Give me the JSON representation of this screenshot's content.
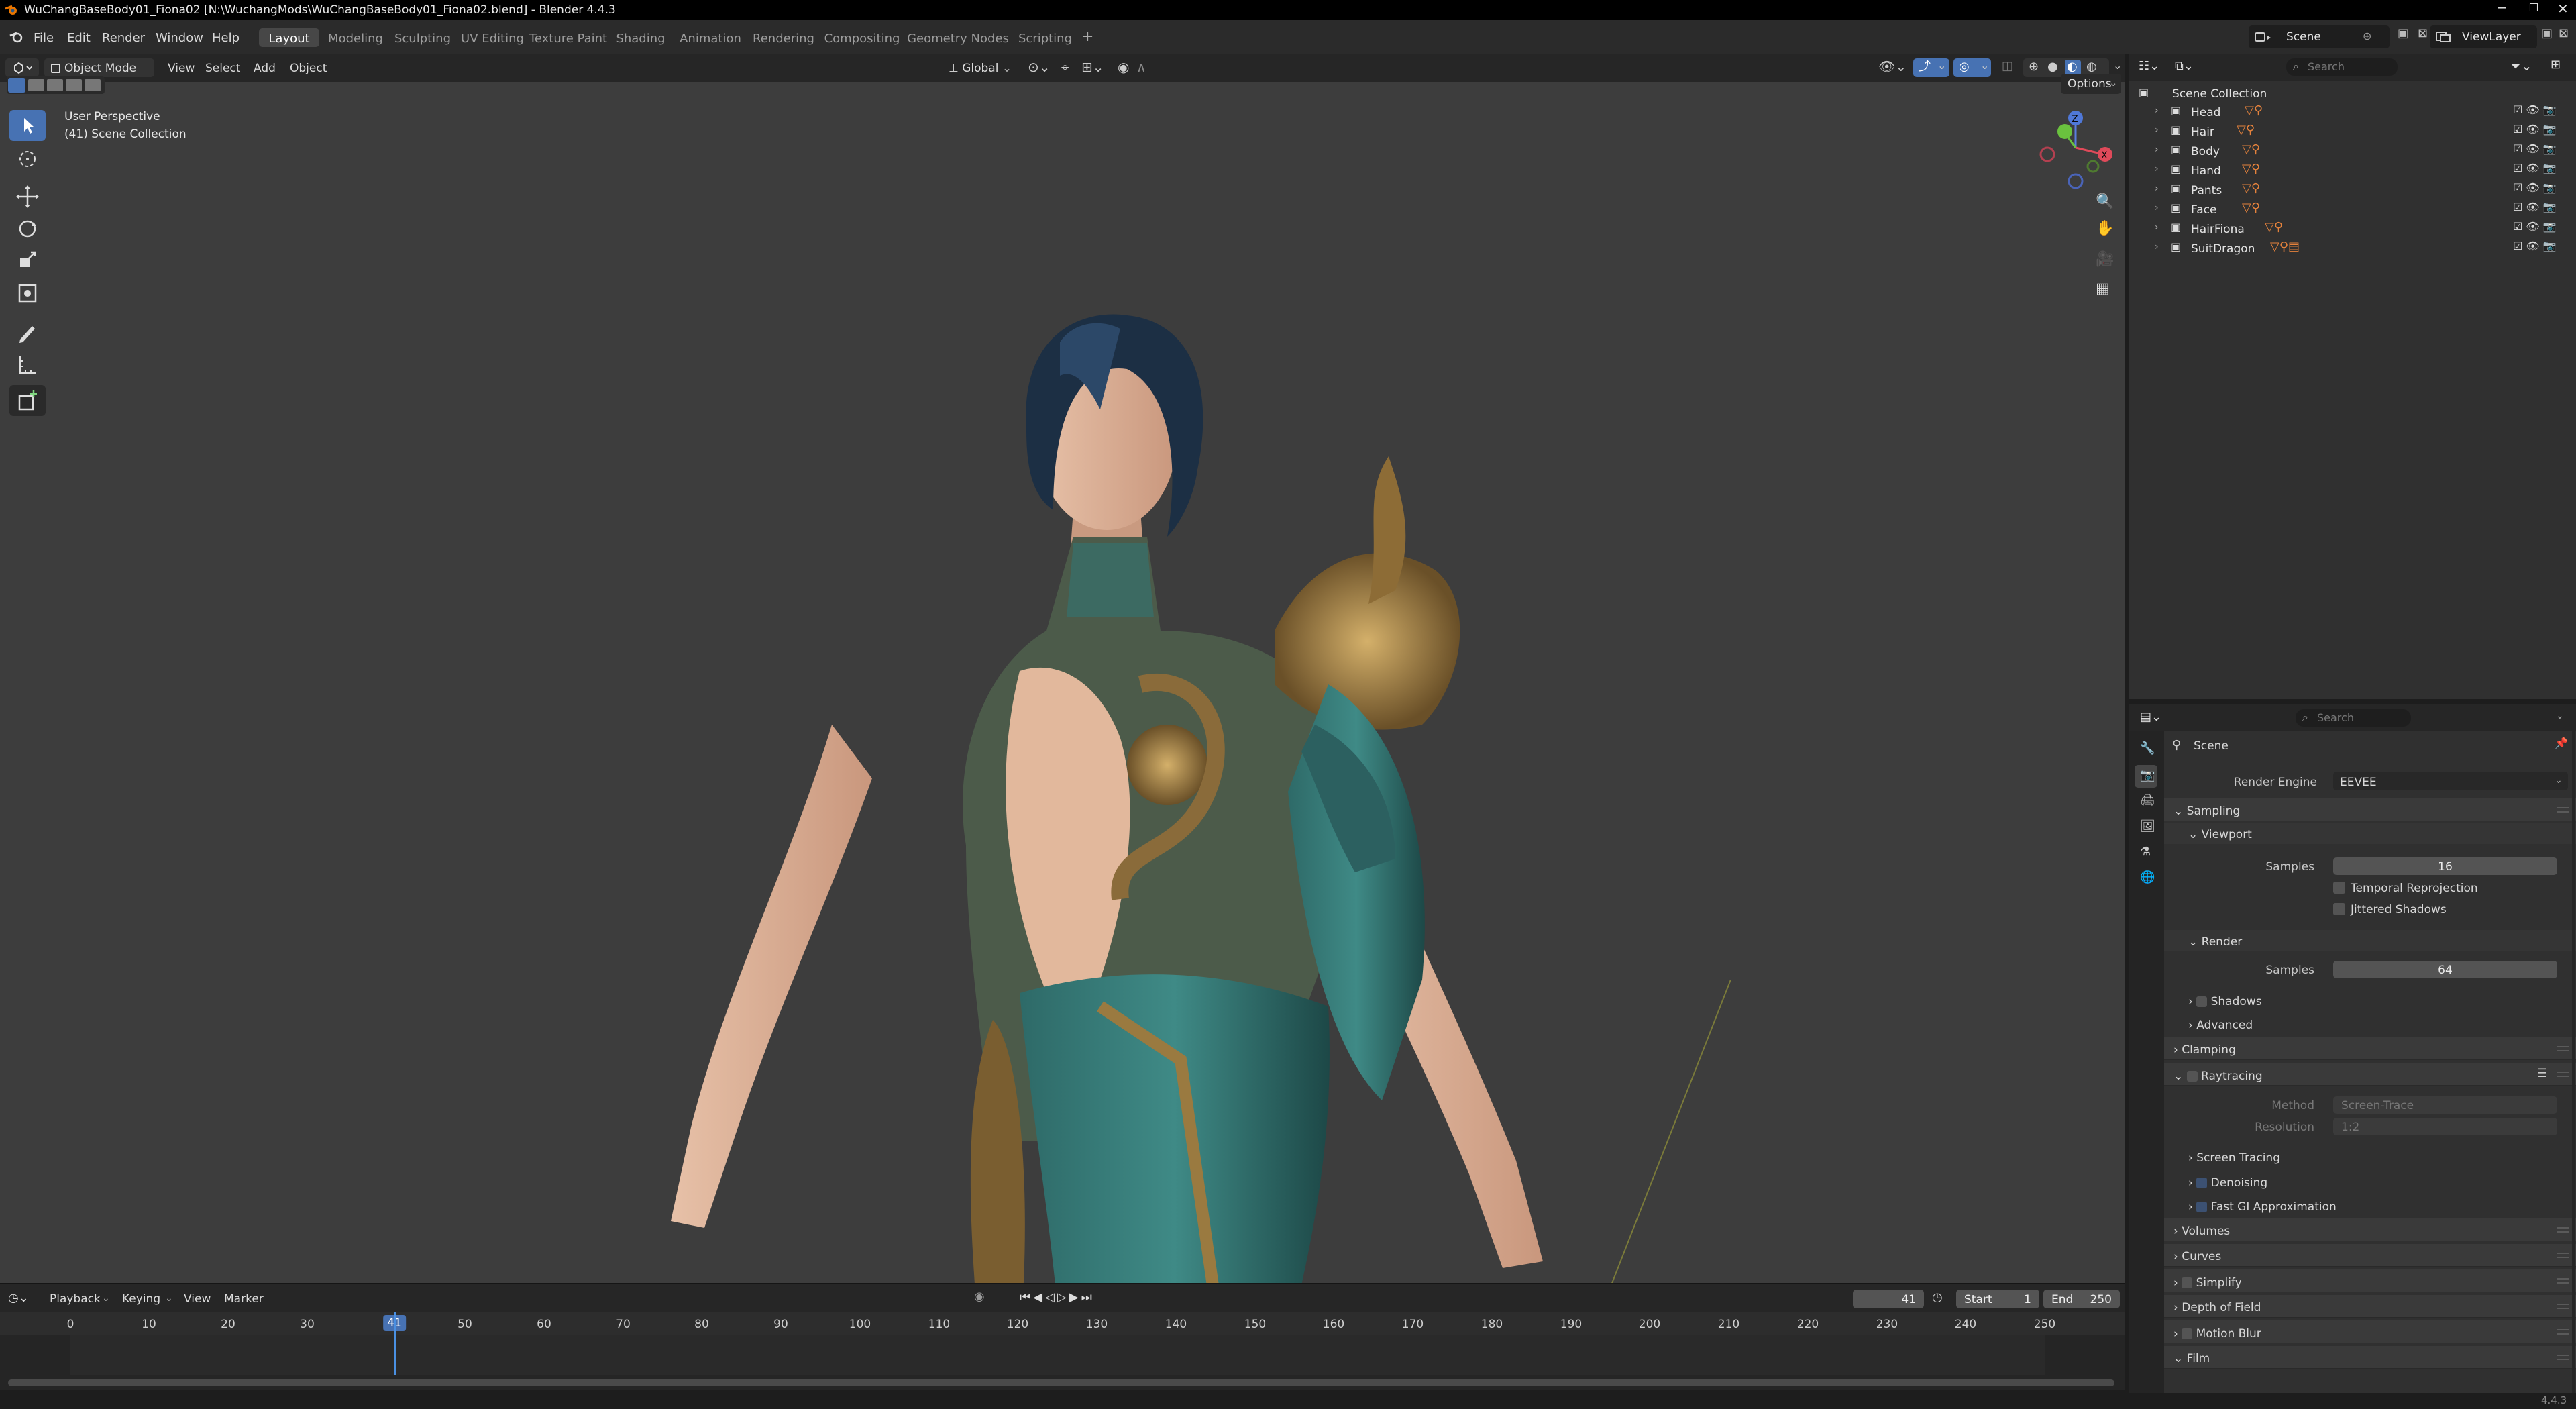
{
  "window": {
    "title": "WuChangBaseBody01_Fiona02 [N:\\WuchangMods\\WuChangBaseBody01_Fiona02.blend] - Blender 4.4.3"
  },
  "menubar": {
    "file": "File",
    "edit": "Edit",
    "render": "Render",
    "window": "Window",
    "help": "Help"
  },
  "workspaces": [
    "Layout",
    "Modeling",
    "Sculpting",
    "UV Editing",
    "Texture Paint",
    "Shading",
    "Animation",
    "Rendering",
    "Compositing",
    "Geometry Nodes",
    "Scripting"
  ],
  "topright": {
    "scene": "Scene",
    "view_layer": "ViewLayer"
  },
  "viewport": {
    "mode": "Object Mode",
    "menus": [
      "View",
      "Select",
      "Add",
      "Object"
    ],
    "orientation": "Global",
    "options": "Options",
    "overlay_line1": "User Perspective",
    "overlay_line2": "(41) Scene Collection",
    "gizmo": {
      "z": "Z",
      "y": "Y",
      "x": "X"
    }
  },
  "timeline": {
    "menus": [
      "Playback",
      "Keying",
      "View",
      "Marker"
    ],
    "current_frame": "41",
    "start_label": "Start",
    "start": "1",
    "end_label": "End",
    "end": "250",
    "ticks": [
      "0",
      "10",
      "20",
      "30",
      "41",
      "50",
      "60",
      "70",
      "80",
      "90",
      "100",
      "110",
      "120",
      "130",
      "140",
      "150",
      "160",
      "170",
      "180",
      "190",
      "200",
      "210",
      "220",
      "230",
      "240",
      "250"
    ]
  },
  "outliner": {
    "search_placeholder": "Search",
    "root": "Scene Collection",
    "items": [
      "Head",
      "Hair",
      "Body",
      "Hand",
      "Pants",
      "Face",
      "HairFiona",
      "SuitDragon"
    ]
  },
  "properties": {
    "search_placeholder": "Search",
    "context": "Scene",
    "render_engine_label": "Render Engine",
    "render_engine": "EEVEE",
    "sampling": "Sampling",
    "viewport": "Viewport",
    "samples_label": "Samples",
    "viewport_samples": "16",
    "temporal_reprojection": "Temporal Reprojection",
    "jittered_shadows": "Jittered Shadows",
    "render": "Render",
    "render_samples": "64",
    "shadows": "Shadows",
    "advanced": "Advanced",
    "clamping": "Clamping",
    "raytracing": "Raytracing",
    "method_label": "Method",
    "method": "Screen-Trace",
    "resolution_label": "Resolution",
    "resolution": "1:2",
    "screen_tracing": "Screen Tracing",
    "denoising": "Denoising",
    "fast_gi": "Fast GI Approximation",
    "volumes": "Volumes",
    "curves": "Curves",
    "simplify": "Simplify",
    "depth_of_field": "Depth of Field",
    "motion_blur": "Motion Blur",
    "film": "Film"
  },
  "status": {
    "version": "4.4.3"
  },
  "colors": {
    "accent": "#4772b3",
    "active_frame": "#4a90e2",
    "object_orange": "#e5823c"
  }
}
